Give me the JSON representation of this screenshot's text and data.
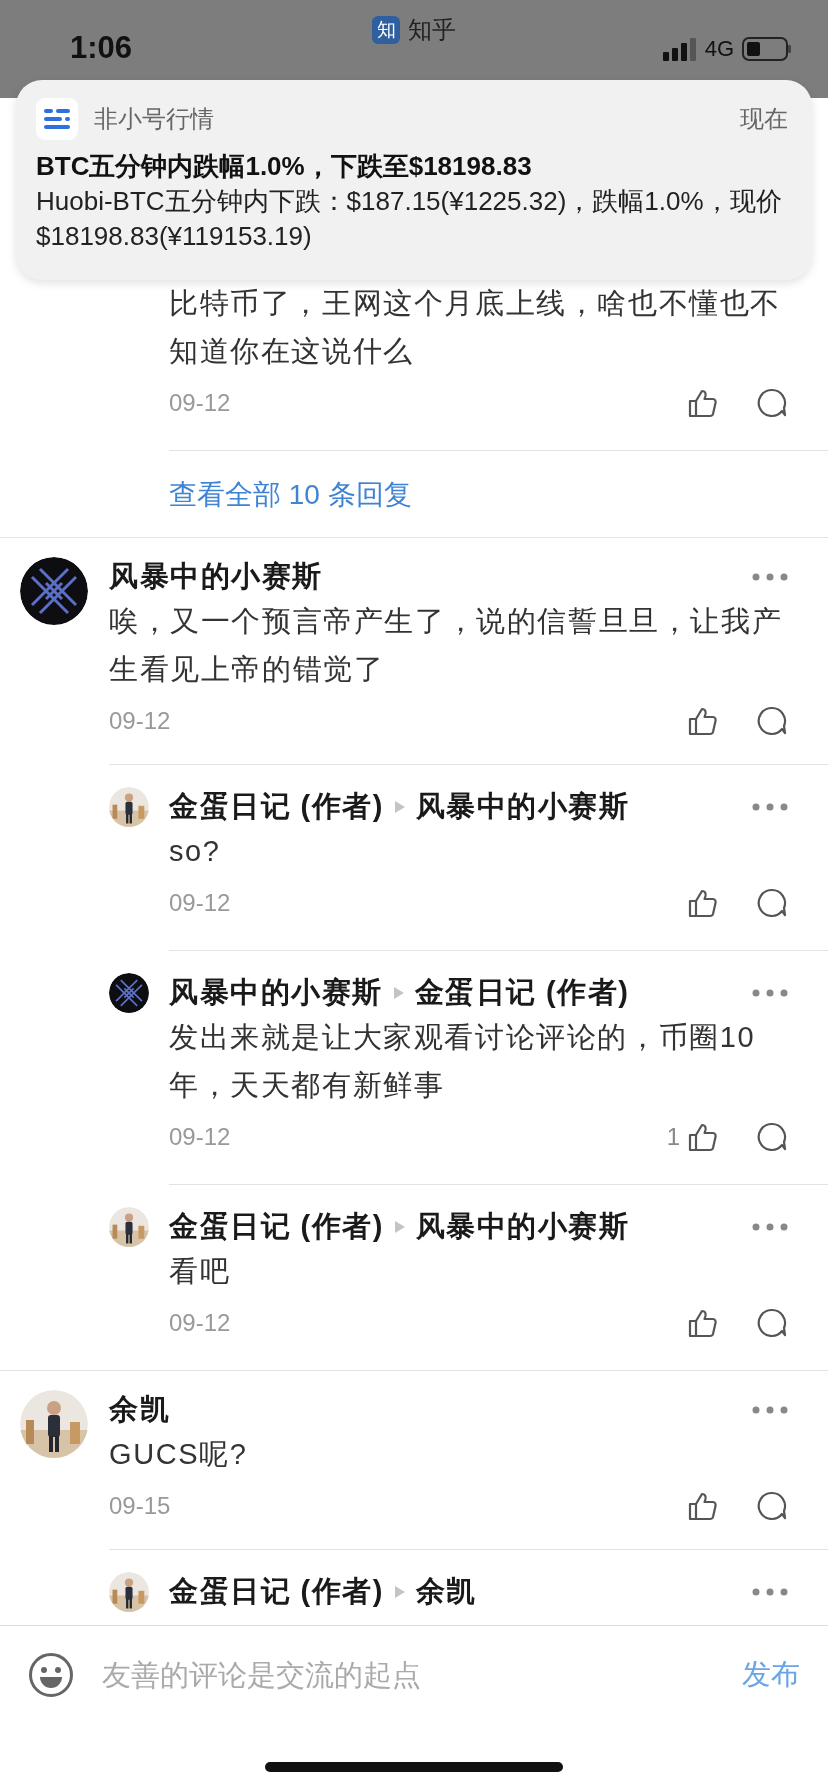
{
  "status_bar": {
    "time": "1:06",
    "app_badge": "知",
    "app_name": "知乎",
    "network": "4G"
  },
  "notification": {
    "app": "非小号行情",
    "time": "现在",
    "title": "BTC五分钟内跌幅1.0%，下跌至$18198.83",
    "body": "Huobi-BTC五分钟内下跌：$187.15(¥1225.32)，跌幅1.0%，现价$18198.83(¥119153.19)"
  },
  "threads": [
    {
      "replies": [
        {
          "text": "比特币了，王网这个月底上线，啥也不懂也不知道你在这说什么",
          "date": "09-12"
        }
      ],
      "more_link": "查看全部 10 条回复"
    },
    {
      "author": "风暴中的小赛斯",
      "avatar": {
        "kind": "pattern"
      },
      "text": "唉，又一个预言帝产生了，说的信誓旦旦，让我产生看见上帝的错觉了",
      "date": "09-12",
      "replies": [
        {
          "author": "金蛋日记 (作者)",
          "reply_to": "风暴中的小赛斯",
          "text": "so?",
          "date": "09-12"
        },
        {
          "author": "风暴中的小赛斯",
          "avatar": {
            "kind": "pattern"
          },
          "reply_to": "金蛋日记 (作者)",
          "text": "发出来就是让大家观看讨论评论的，币圈10年，天天都有新鲜事",
          "date": "09-12",
          "likes": "1"
        },
        {
          "author": "金蛋日记 (作者)",
          "reply_to": "风暴中的小赛斯",
          "text": "看吧",
          "date": "09-12"
        }
      ]
    },
    {
      "author": "余凯",
      "text": "GUCS呢?",
      "date": "09-15",
      "replies": [
        {
          "author": "金蛋日记 (作者)",
          "reply_to": "余凯"
        }
      ]
    }
  ],
  "composer": {
    "placeholder": "友善的评论是交流的起点",
    "send": "发布"
  }
}
